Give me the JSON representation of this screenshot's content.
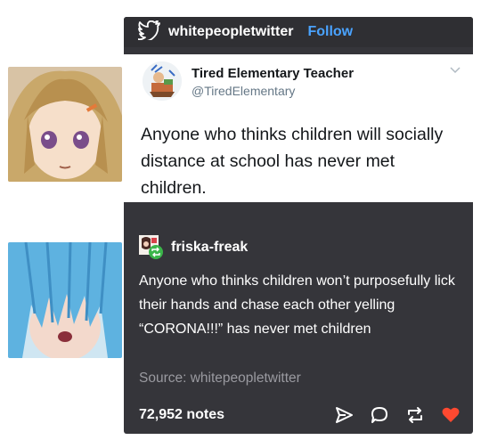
{
  "post": {
    "blog_name": "whitepeopletwitter",
    "follow_label": "Follow",
    "header_icon": "twitter-bird-icon"
  },
  "tweet": {
    "display_name": "Tired Elementary Teacher",
    "handle": "@TiredElementary",
    "text": "Anyone who thinks children will socially distance at school has never met children."
  },
  "reblog": {
    "blog_name": "friska-freak",
    "text": "Anyone who thinks children won’t purposefully lick their hands and chase each other yelling “CORONA!!!” has never met children",
    "source": "Source: whitepeopletwitter"
  },
  "footer": {
    "notes": "72,952 notes",
    "actions": [
      "share-icon",
      "reply-icon",
      "reblog-icon",
      "like-icon"
    ],
    "like_color": "#ff4930"
  }
}
